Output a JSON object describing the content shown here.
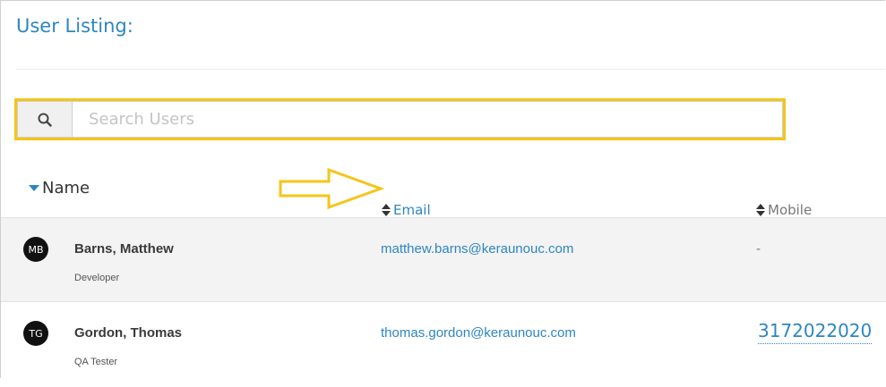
{
  "page": {
    "title": "User Listing:"
  },
  "search": {
    "placeholder": "Search Users",
    "value": ""
  },
  "table": {
    "columns": [
      {
        "label": "Name",
        "sort": "desc"
      },
      {
        "label": "Email",
        "sort": "none"
      },
      {
        "label": "Mobile",
        "sort": "none"
      }
    ],
    "rows": [
      {
        "initials": "MB",
        "name": "Barns, Matthew",
        "role": "Developer",
        "email": "matthew.barns@keraunouc.com",
        "mobile": "-"
      },
      {
        "initials": "TG",
        "name": "Gordon, Thomas",
        "role": "QA Tester",
        "email": "thomas.gordon@keraunouc.com",
        "mobile": "3172022020"
      }
    ]
  },
  "colors": {
    "accent": "#2e86c1",
    "highlight": "#f5c518",
    "row_alt": "#f3f3f3"
  },
  "icons": {
    "search": "search-icon",
    "sort_active": "sort-desc-icon",
    "sort_both": "sort-icon",
    "annotation": "arrow-annotation"
  }
}
